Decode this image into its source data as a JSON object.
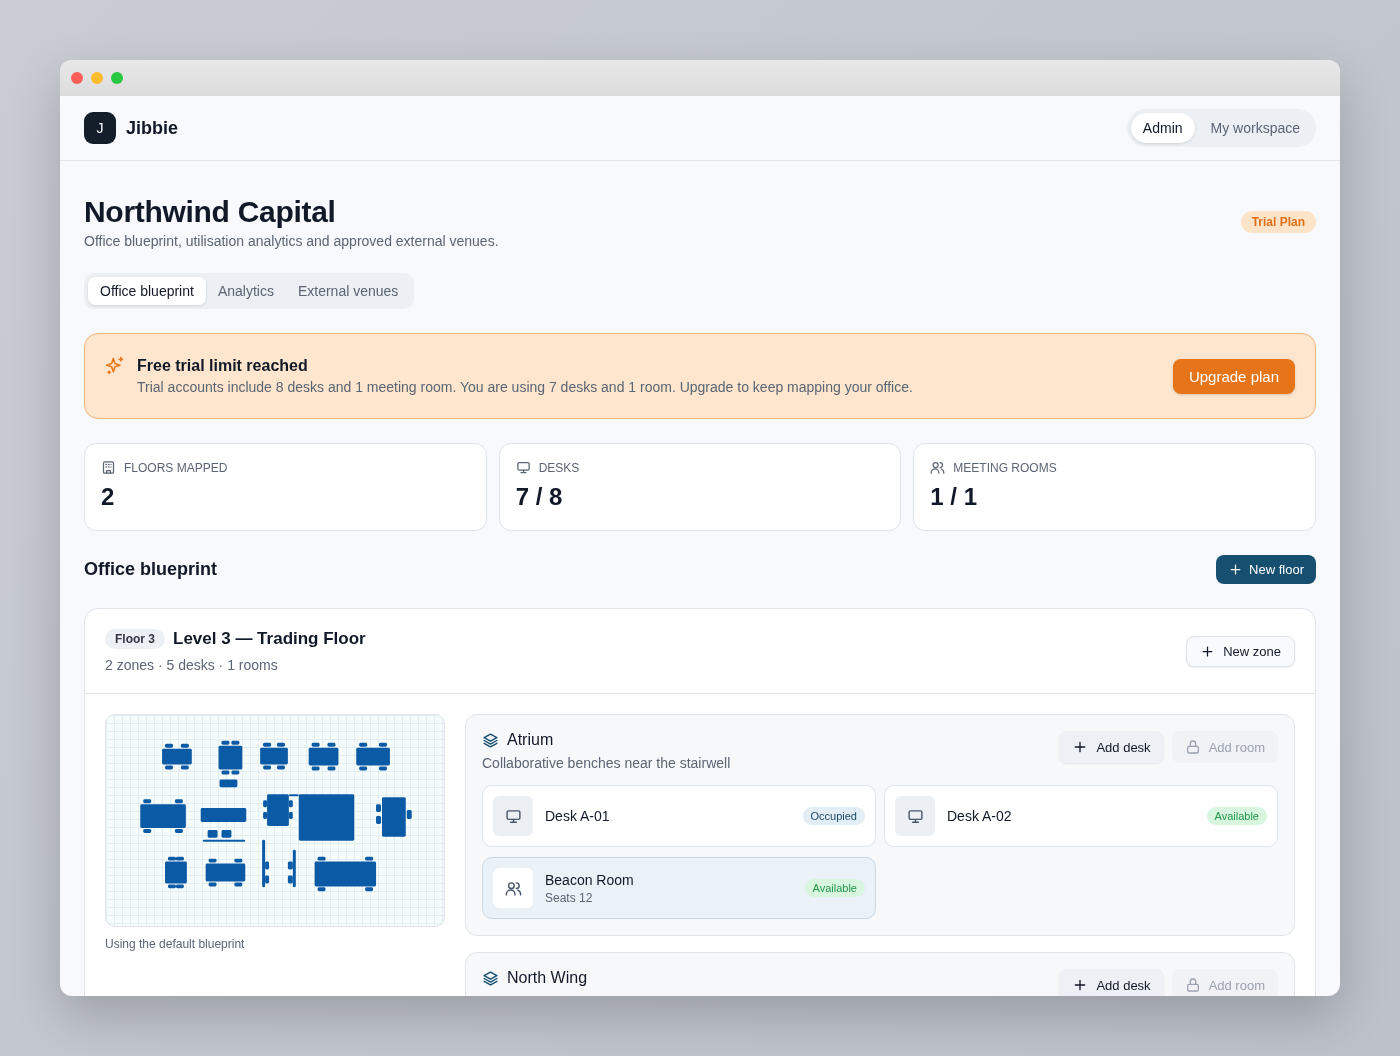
{
  "brand": {
    "logo_letter": "J",
    "name": "Jibbie"
  },
  "mode_switch": [
    {
      "label": "Admin",
      "selected": true
    },
    {
      "label": "My workspace",
      "selected": false
    }
  ],
  "page": {
    "title": "Northwind Capital",
    "subtitle": "Office blueprint, utilisation analytics and approved external venues.",
    "plan_badge": "Trial Plan"
  },
  "tabs": [
    {
      "label": "Office blueprint",
      "selected": true
    },
    {
      "label": "Analytics",
      "selected": false
    },
    {
      "label": "External venues",
      "selected": false
    }
  ],
  "alert": {
    "title": "Free trial limit reached",
    "message": "Trial accounts include 8 desks and 1 meeting room. You are using 7 desks and 1 room. Upgrade to keep mapping your office.",
    "button": "Upgrade plan"
  },
  "stats": [
    {
      "kind": "floors",
      "label": "FLOORS MAPPED",
      "value": "2"
    },
    {
      "kind": "desks",
      "label": "DESKS",
      "value": "7 / 8"
    },
    {
      "kind": "rooms",
      "label": "MEETING ROOMS",
      "value": "1 / 1"
    }
  ],
  "section": {
    "title": "Office blueprint",
    "button": "New floor"
  },
  "floor": {
    "badge": "Floor 3",
    "title": "Level 3 — Trading Floor",
    "meta": "2 zones · 5 desks · 1 rooms",
    "button": "New zone",
    "blueprint_caption": "Using the default blueprint",
    "zones": [
      {
        "name": "Atrium",
        "description": "Collaborative benches near the stairwell",
        "add_desk": {
          "label": "Add desk",
          "disabled": false
        },
        "add_room": {
          "label": "Add room",
          "disabled": true
        },
        "items": [
          {
            "kind": "desk",
            "name": "Desk A-01",
            "status": {
              "kind": "occupied",
              "label": "Occupied"
            }
          },
          {
            "kind": "desk",
            "name": "Desk A-02",
            "status": {
              "kind": "available",
              "label": "Available"
            }
          },
          {
            "kind": "room",
            "name": "Beacon Room",
            "detail": "Seats 12",
            "status": {
              "kind": "available",
              "label": "Available"
            }
          }
        ]
      },
      {
        "name": "North Wing",
        "add_desk": {
          "label": "Add desk",
          "disabled": false
        },
        "add_room": {
          "label": "Add room",
          "disabled": true
        }
      }
    ]
  }
}
